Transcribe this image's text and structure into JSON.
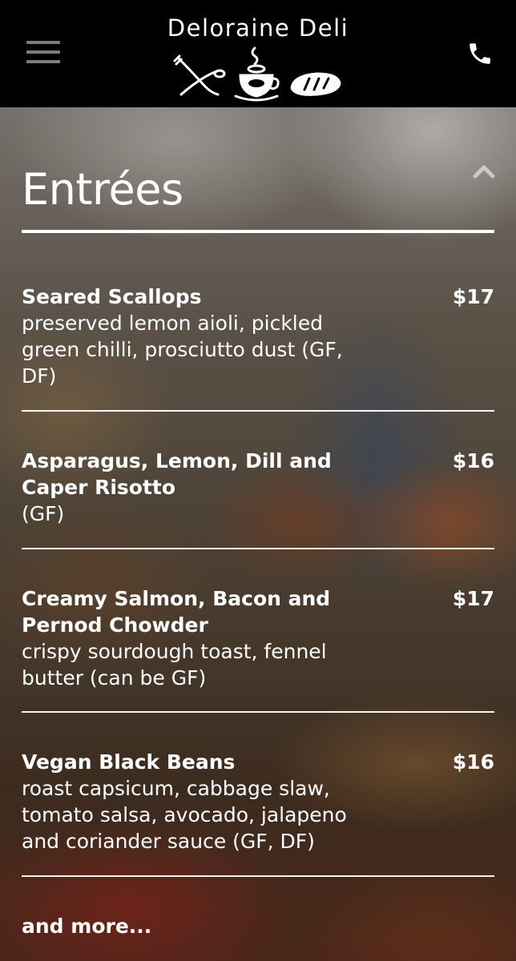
{
  "header": {
    "brand_name": "Deloraine Deli",
    "menu_icon": "hamburger-menu-icon",
    "phone_icon": "phone-icon",
    "logo_icons": [
      "utensils-icon",
      "coffee-cup-icon",
      "bread-loaf-icon"
    ]
  },
  "section": {
    "title": "Entrées",
    "collapse_icon": "chevron-up-icon"
  },
  "items": [
    {
      "name": "Seared Scallops",
      "description": "preserved lemon aioli, pickled green chilli, prosciutto dust (GF, DF)",
      "price": "$17"
    },
    {
      "name": "Asparagus, Lemon, Dill and Caper Risotto",
      "description": "(GF)",
      "price": "$16"
    },
    {
      "name": "Creamy Salmon, Bacon and Pernod Chowder",
      "description": "crispy sourdough toast, fennel butter (can be GF)",
      "price": "$17"
    },
    {
      "name": "Vegan Black Beans",
      "description": "roast capsicum, cabbage slaw, tomato salsa, avocado, jalapeno and coriander sauce (GF, DF)",
      "price": "$16"
    }
  ],
  "more_label": "and more...",
  "colors": {
    "header_bg": "#000000",
    "text": "#ffffff",
    "menu_icon": "#7c7c7c"
  }
}
